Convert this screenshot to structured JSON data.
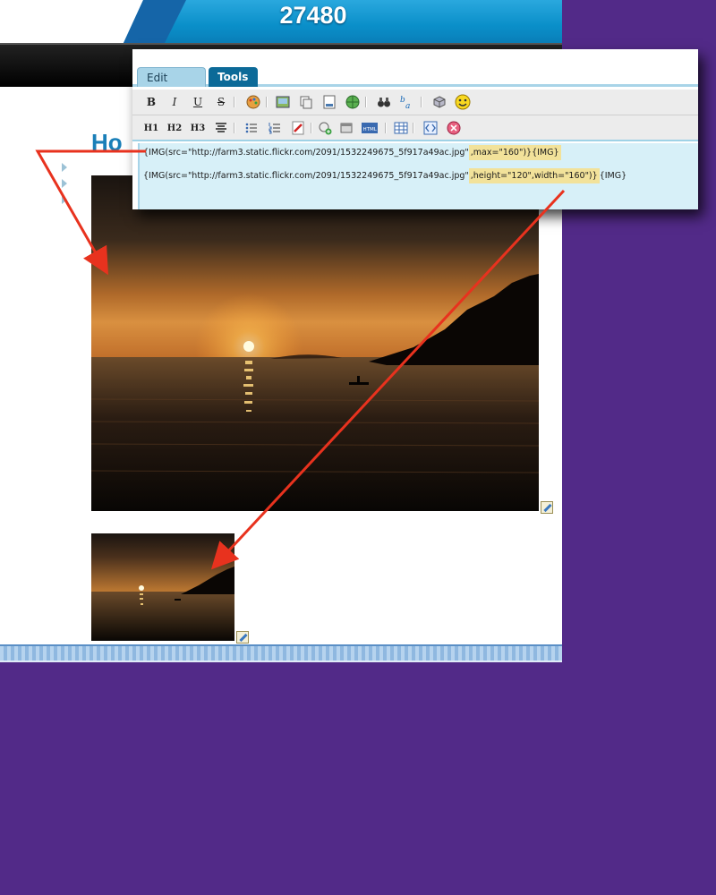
{
  "header": {
    "counter": "27480"
  },
  "page": {
    "title": "Ho"
  },
  "editor": {
    "tabs": [
      {
        "label": "Edit page",
        "active": true
      },
      {
        "label": "Tools",
        "active": false
      }
    ],
    "toolbar_row1": [
      "bold-button",
      "italic-button",
      "underline-button",
      "strikethrough-button",
      "color-button",
      "image-button",
      "copy-button",
      "save-button",
      "link-button",
      "find-button",
      "spellcheck-button",
      "plugin-button",
      "smiley-button"
    ],
    "toolbar_row2": [
      "h1-button",
      "h2-button",
      "h3-button",
      "center-button",
      "unordered-list-button",
      "ordered-list-button",
      "attach-button",
      "add-button",
      "box-button",
      "html-button",
      "table-button",
      "code-button",
      "stop-button"
    ],
    "labels": {
      "bold": "B",
      "italic": "I",
      "underline": "U",
      "strike": "S",
      "h1": "H1",
      "h2": "H2",
      "h3": "H3"
    },
    "lines": [
      {
        "prefix": "{IMG(src=\"http://farm3.static.flickr.com/2091/1532249675_5f917a49ac.jpg\"",
        "highlight": ",max=\"160\")}{IMG}",
        "suffix": ""
      },
      {
        "prefix": "{IMG(src=\"http://farm3.static.flickr.com/2091/1532249675_5f917a49ac.jpg\"",
        "highlight": ",height=\"120\",width=\"160\")}",
        "suffix": "{IMG}"
      }
    ]
  },
  "colors": {
    "background": "#522a88",
    "accent_blue": "#1a7fb8",
    "arrow": "#e8321e",
    "highlight": "#f2e29a"
  }
}
